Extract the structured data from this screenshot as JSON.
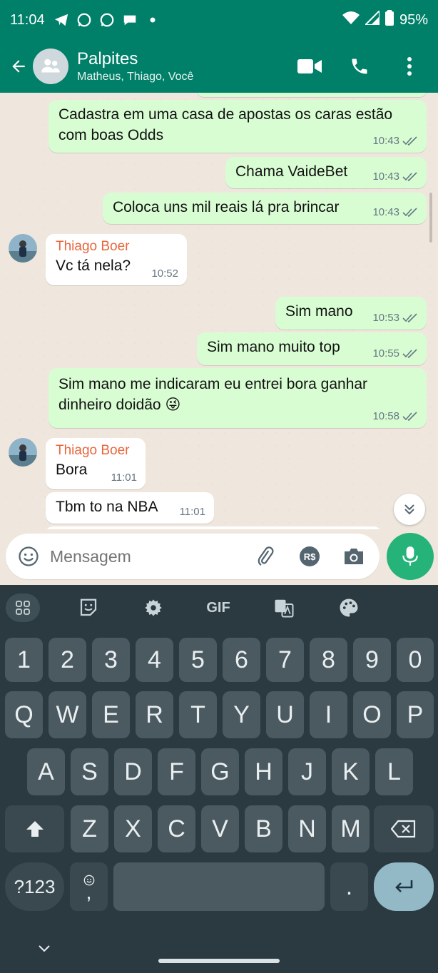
{
  "status_bar": {
    "time": "11:04",
    "battery": "95%",
    "icons": [
      "telegram-icon",
      "whatsapp-icon",
      "whatsapp-icon",
      "messages-icon",
      "dot-icon",
      "wifi-icon",
      "signal-icon",
      "battery-icon"
    ]
  },
  "header": {
    "title": "Palpites",
    "subtitle": "Matheus, Thiago, Você",
    "color": "#008069"
  },
  "messages": [
    {
      "dir": "out",
      "text": "Cadastra em uma casa de apostas os caras estão com boas Odds",
      "time": "10:43",
      "ticks": "read"
    },
    {
      "dir": "out",
      "text": "Chama VaideBet",
      "time": "10:43",
      "ticks": "read"
    },
    {
      "dir": "out",
      "text": "Coloca uns mil reais lá pra brincar",
      "time": "10:43",
      "ticks": "read"
    },
    {
      "dir": "in",
      "sender": "Thiago Boer",
      "text": "Vc tá nela?",
      "time": "10:52"
    },
    {
      "dir": "out",
      "text": "Sim mano",
      "time": "10:53",
      "ticks": "read"
    },
    {
      "dir": "out",
      "text": "Sim mano muito top",
      "time": "10:55",
      "ticks": "read"
    },
    {
      "dir": "out",
      "text": "Sim mano me indicaram eu entrei bora ganhar dinheiro doidão",
      "emoji": "😜",
      "time": "10:58",
      "ticks": "read"
    },
    {
      "dir": "in",
      "sender": "Thiago Boer",
      "text": "Bora",
      "time": "11:01"
    },
    {
      "dir": "in",
      "text": "Tbm to na NBA",
      "time": "11:01"
    }
  ],
  "composer": {
    "placeholder": "Mensagem",
    "pay_label": "R$"
  },
  "keyboard": {
    "toolbar": [
      "grid-icon",
      "sticker-icon",
      "settings-icon",
      "GIF",
      "translate-icon",
      "palette-icon"
    ],
    "gif_label": "GIF",
    "row1": [
      "1",
      "2",
      "3",
      "4",
      "5",
      "6",
      "7",
      "8",
      "9",
      "0"
    ],
    "row2": [
      "Q",
      "W",
      "E",
      "R",
      "T",
      "Y",
      "U",
      "I",
      "O",
      "P"
    ],
    "row3": [
      "A",
      "S",
      "D",
      "F",
      "G",
      "H",
      "J",
      "K",
      "L"
    ],
    "row4": [
      "Z",
      "X",
      "C",
      "V",
      "B",
      "N",
      "M"
    ],
    "symbols_label": "?123",
    "comma_label": ",",
    "period_label": "."
  },
  "colors": {
    "outgoing_bubble": "#d9fdd3",
    "incoming_bubble": "#ffffff",
    "sender_name": "#e8663c",
    "read_ticks": "#667781",
    "mic_button": "#25b37a"
  }
}
